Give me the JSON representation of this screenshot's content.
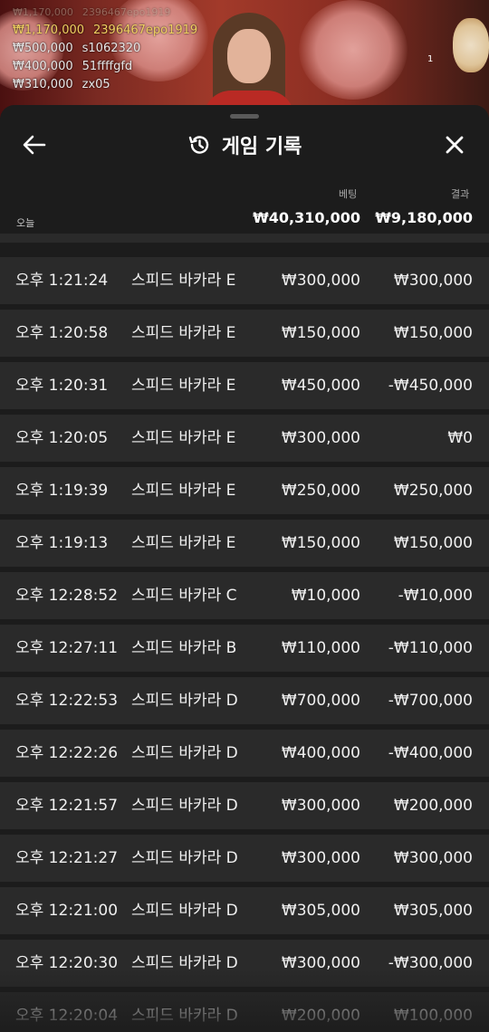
{
  "video": {
    "bettors": [
      {
        "amount": "₩1,170,000",
        "user": "2396467epo1919",
        "highlight": true
      },
      {
        "amount": "₩500,000",
        "user": "s1062320",
        "highlight": false
      },
      {
        "amount": "₩400,000",
        "user": "51ffffgfd",
        "highlight": false
      },
      {
        "amount": "₩310,000",
        "user": "zx05",
        "highlight": false
      }
    ],
    "marker": "1"
  },
  "header": {
    "title": "게임 기록",
    "back_icon": "arrow-left-icon",
    "history_icon": "history-clock-icon",
    "close_icon": "close-icon"
  },
  "columns": {
    "bet": "베팅",
    "result": "결과"
  },
  "summary": {
    "period": "오늘",
    "total_bet": "₩40,310,000",
    "total_result": "₩9,180,000"
  },
  "rows": [
    {
      "time": "오후 1:21:24",
      "game": "스피드 바카라 E",
      "bet": "₩300,000",
      "result": "₩300,000"
    },
    {
      "time": "오후 1:20:58",
      "game": "스피드 바카라 E",
      "bet": "₩150,000",
      "result": "₩150,000"
    },
    {
      "time": "오후 1:20:31",
      "game": "스피드 바카라 E",
      "bet": "₩450,000",
      "result": "-₩450,000"
    },
    {
      "time": "오후 1:20:05",
      "game": "스피드 바카라 E",
      "bet": "₩300,000",
      "result": "₩0"
    },
    {
      "time": "오후 1:19:39",
      "game": "스피드 바카라 E",
      "bet": "₩250,000",
      "result": "₩250,000"
    },
    {
      "time": "오후 1:19:13",
      "game": "스피드 바카라 E",
      "bet": "₩150,000",
      "result": "₩150,000"
    },
    {
      "time": "오후 12:28:52",
      "game": "스피드 바카라 C",
      "bet": "₩10,000",
      "result": "-₩10,000"
    },
    {
      "time": "오후 12:27:11",
      "game": "스피드 바카라 B",
      "bet": "₩110,000",
      "result": "-₩110,000"
    },
    {
      "time": "오후 12:22:53",
      "game": "스피드 바카라 D",
      "bet": "₩700,000",
      "result": "-₩700,000"
    },
    {
      "time": "오후 12:22:26",
      "game": "스피드 바카라 D",
      "bet": "₩400,000",
      "result": "-₩400,000"
    },
    {
      "time": "오후 12:21:57",
      "game": "스피드 바카라 D",
      "bet": "₩300,000",
      "result": "₩200,000"
    },
    {
      "time": "오후 12:21:27",
      "game": "스피드 바카라 D",
      "bet": "₩300,000",
      "result": "₩300,000"
    },
    {
      "time": "오후 12:21:00",
      "game": "스피드 바카라 D",
      "bet": "₩305,000",
      "result": "₩305,000"
    },
    {
      "time": "오후 12:20:30",
      "game": "스피드 바카라 D",
      "bet": "₩300,000",
      "result": "-₩300,000"
    },
    {
      "time": "오후 12:20:04",
      "game": "스피드 바카라 D",
      "bet": "₩200,000",
      "result": "₩100,000"
    }
  ]
}
